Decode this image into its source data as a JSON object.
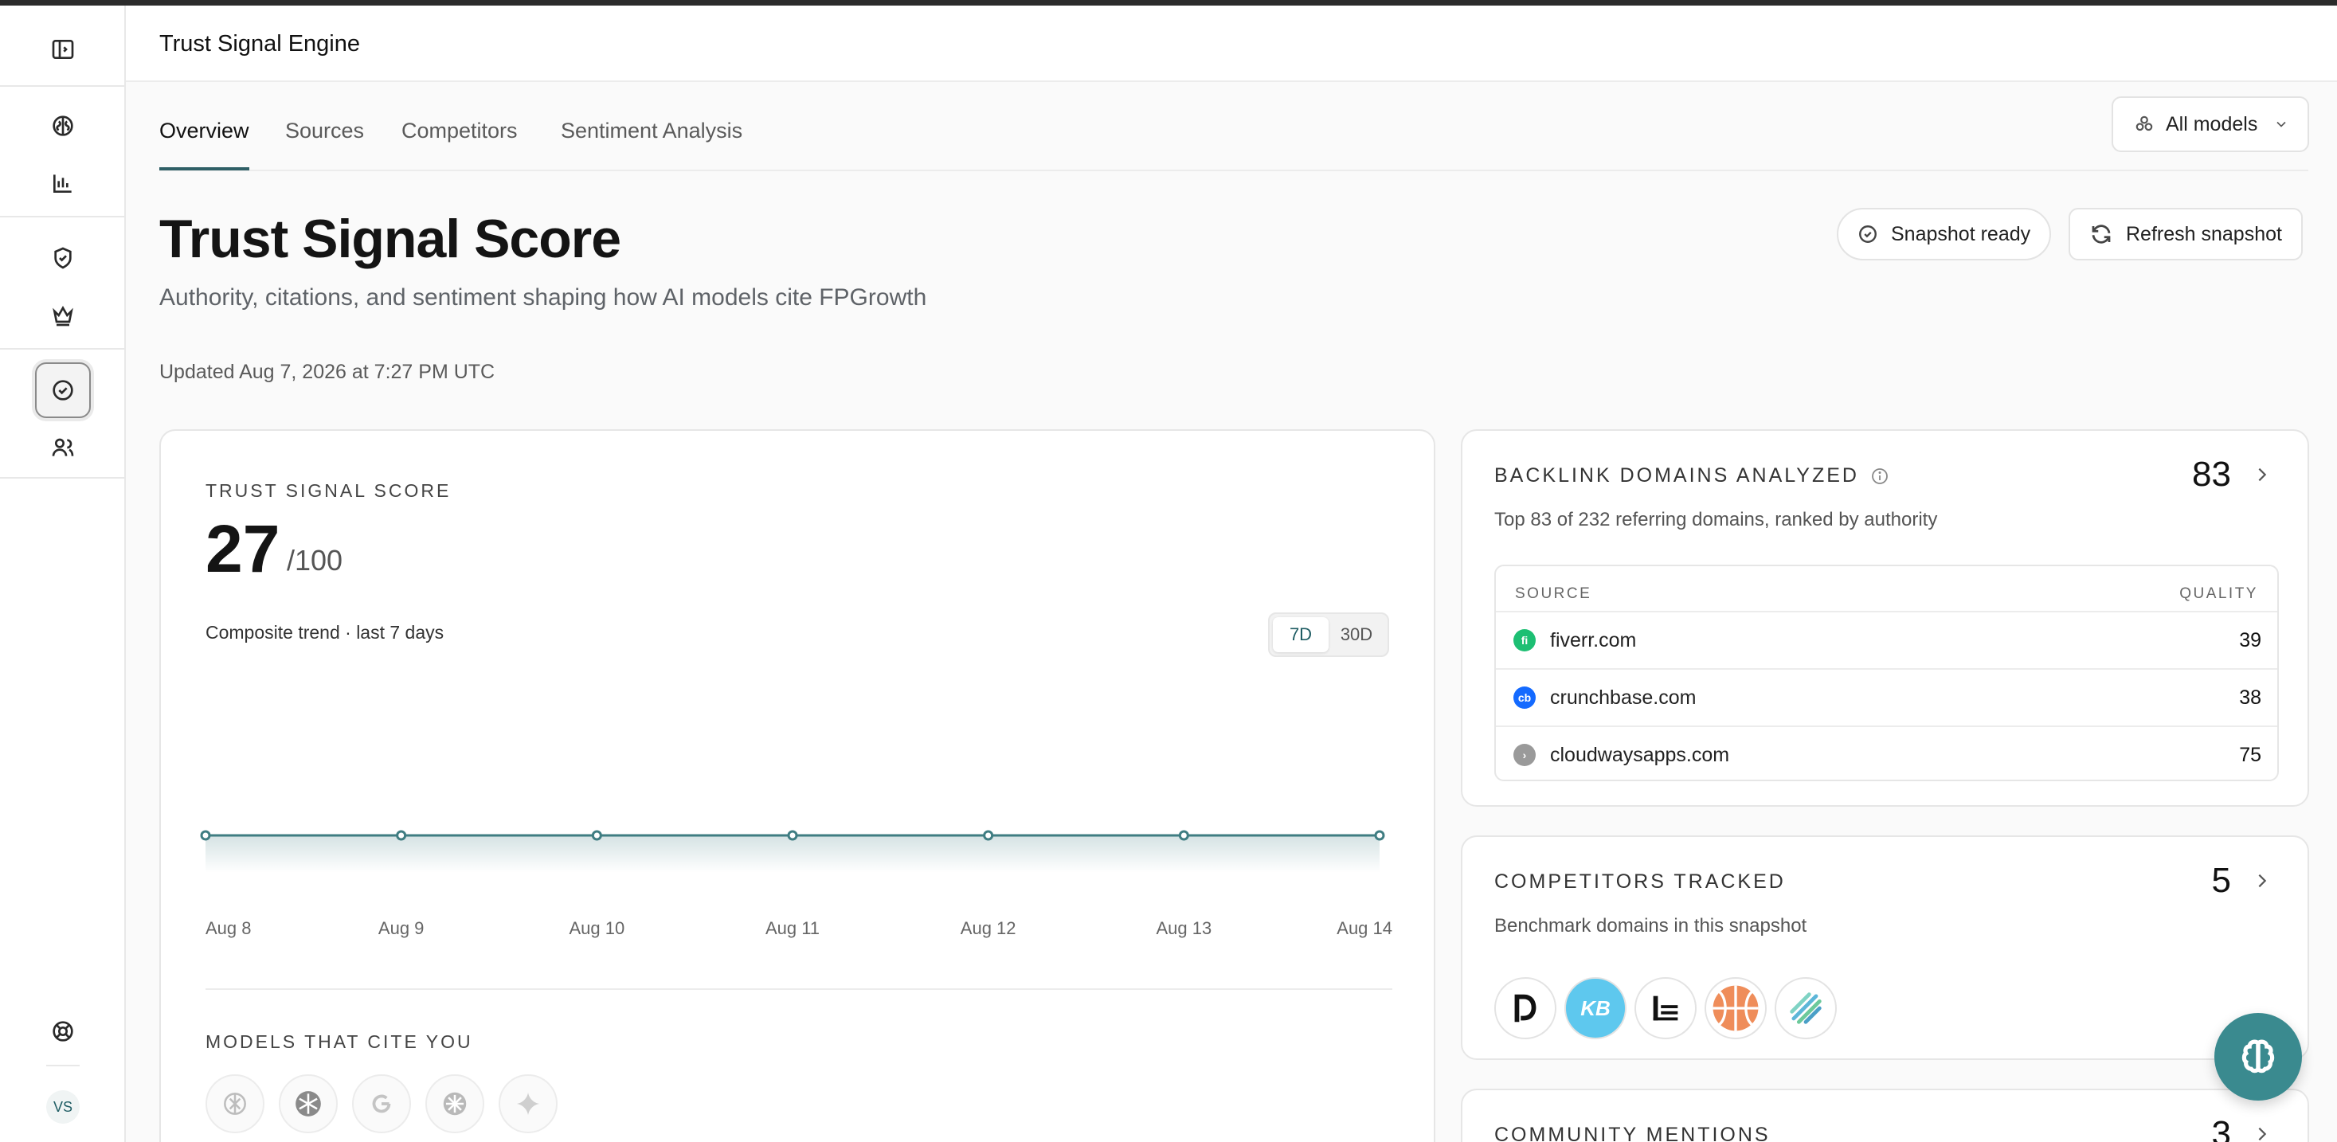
{
  "header": {
    "app_title": "Trust Signal Engine"
  },
  "tabs": [
    {
      "label": "Overview",
      "active": true
    },
    {
      "label": "Sources",
      "active": false
    },
    {
      "label": "Competitors",
      "active": false
    },
    {
      "label": "Sentiment Analysis",
      "active": false
    }
  ],
  "model_filter": {
    "selected": "All models"
  },
  "page": {
    "title": "Trust Signal Score",
    "subtitle": "Authority, citations, and sentiment shaping how AI models cite FPGrowth",
    "updated": "Updated Aug 7, 2026 at 7:27 PM UTC",
    "snapshot_status": "Snapshot ready",
    "refresh_label": "Refresh snapshot"
  },
  "score_card": {
    "eyebrow": "TRUST SIGNAL SCORE",
    "score": "27",
    "max": "/100",
    "trend_label": "Composite trend · last 7 days",
    "ranges": [
      "7D",
      "30D"
    ],
    "selected_range": "7D",
    "models_eyebrow": "MODELS THAT CITE YOU",
    "models": [
      "openai-icon",
      "perplexity-icon",
      "google-icon",
      "claude-icon",
      "gemini-icon"
    ]
  },
  "chart_data": {
    "type": "area",
    "x": [
      "Aug 8",
      "Aug 9",
      "Aug 10",
      "Aug 11",
      "Aug 12",
      "Aug 13",
      "Aug 14"
    ],
    "series": [
      {
        "values": [
          27,
          27,
          27,
          27,
          27,
          27,
          27
        ]
      }
    ],
    "grid": false,
    "legend": "none",
    "color": "#3f7d82"
  },
  "backlinks": {
    "title": "BACKLINK DOMAINS ANALYZED",
    "count": "83",
    "subtitle": "Top 83 of 232 referring domains, ranked by authority",
    "col_source": "SOURCE",
    "col_quality": "QUALITY",
    "rows": [
      {
        "domain": "fiverr.com",
        "quality": "39",
        "favicon_letter": "fi",
        "color": "#1dbf73"
      },
      {
        "domain": "crunchbase.com",
        "quality": "38",
        "favicon_letter": "cb",
        "color": "#146aff"
      },
      {
        "domain": "cloudwaysapps.com",
        "quality": "75",
        "favicon_letter": "›",
        "color": "#9a9a9a"
      }
    ]
  },
  "competitors": {
    "title": "COMPETITORS TRACKED",
    "count": "5",
    "subtitle": "Benchmark domains in this snapshot",
    "logos": [
      "d-logo",
      "kb-logo",
      "lines-logo",
      "basketball-logo",
      "stripes-logo"
    ],
    "kb_text": "KB"
  },
  "community": {
    "title": "COMMUNITY MENTIONS",
    "count": "3"
  },
  "sidebar": {
    "avatar_initials": "VS"
  },
  "colors": {
    "accent": "#2f5f66",
    "fab": "#3a8a8f"
  }
}
